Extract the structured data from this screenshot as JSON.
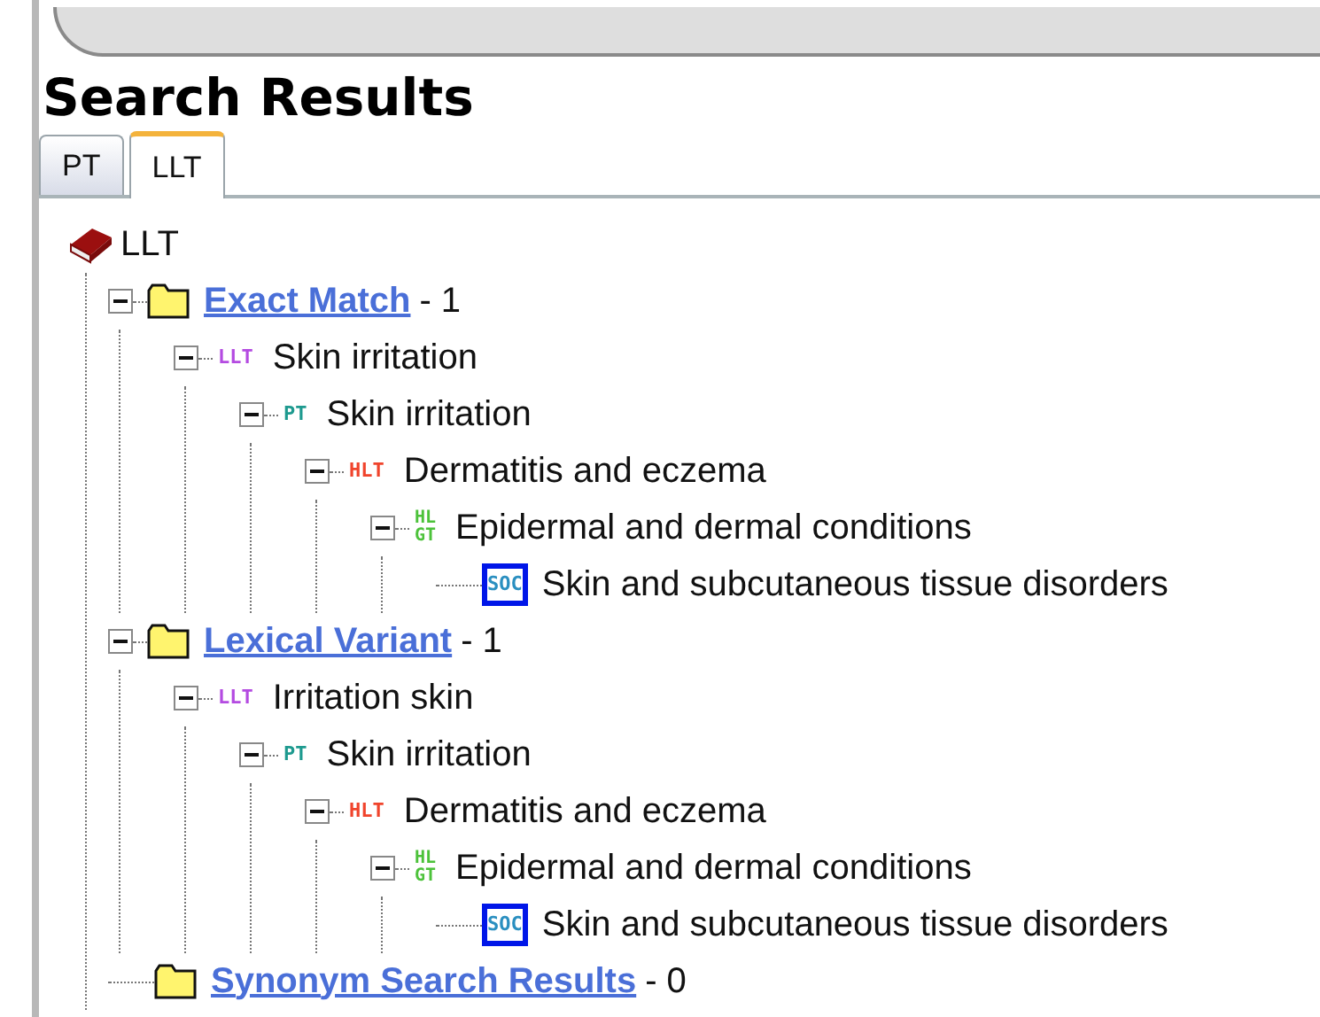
{
  "title": "Search Results",
  "tabs": [
    {
      "label": "PT",
      "selected": false
    },
    {
      "label": "LLT",
      "selected": true
    }
  ],
  "tree": {
    "kind": "root",
    "label": "LLT",
    "children": [
      {
        "kind": "group",
        "label": "Exact Match",
        "count": "- 1",
        "expanded": true,
        "children": [
          {
            "kind": "term",
            "badge": "LLT",
            "color": "#b44be1",
            "label": "Skin irritation",
            "expanded": true,
            "selected": false,
            "children": [
              {
                "kind": "term",
                "badge": "PT",
                "color": "#1e9a8f",
                "label": "Skin irritation",
                "expanded": true,
                "selected": false,
                "children": [
                  {
                    "kind": "term",
                    "badge": "HLT",
                    "color": "#f0442c",
                    "label": "Dermatitis and eczema",
                    "expanded": true,
                    "selected": false,
                    "children": [
                      {
                        "kind": "term",
                        "badge": "HL\nGT",
                        "color": "#4cc23a",
                        "label": "Epidermal and dermal conditions",
                        "expanded": true,
                        "selected": false,
                        "children": [
                          {
                            "kind": "term",
                            "badge": "SOC",
                            "color": "#2a8fc0",
                            "label": "Skin and subcutaneous tissue disorders",
                            "selected": true
                          }
                        ]
                      }
                    ]
                  }
                ]
              }
            ]
          }
        ]
      },
      {
        "kind": "group",
        "label": "Lexical Variant",
        "count": "- 1",
        "expanded": true,
        "children": [
          {
            "kind": "term",
            "badge": "LLT",
            "color": "#b44be1",
            "label": "Irritation skin",
            "expanded": true,
            "selected": false,
            "children": [
              {
                "kind": "term",
                "badge": "PT",
                "color": "#1e9a8f",
                "label": "Skin irritation",
                "expanded": true,
                "selected": false,
                "children": [
                  {
                    "kind": "term",
                    "badge": "HLT",
                    "color": "#f0442c",
                    "label": "Dermatitis and eczema",
                    "expanded": true,
                    "selected": false,
                    "children": [
                      {
                        "kind": "term",
                        "badge": "HL\nGT",
                        "color": "#4cc23a",
                        "label": "Epidermal and dermal conditions",
                        "expanded": true,
                        "selected": false,
                        "children": [
                          {
                            "kind": "term",
                            "badge": "SOC",
                            "color": "#2a8fc0",
                            "label": "Skin and subcutaneous tissue disorders",
                            "selected": true
                          }
                        ]
                      }
                    ]
                  }
                ]
              }
            ]
          }
        ]
      },
      {
        "kind": "group",
        "label": "Synonym Search Results",
        "count": "- 0"
      }
    ]
  }
}
